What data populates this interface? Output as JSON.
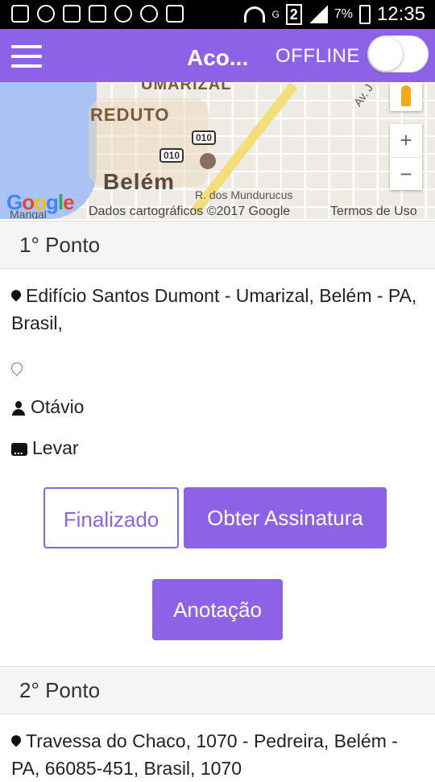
{
  "statusbar": {
    "badge": "2",
    "battery": "7%",
    "time": "12:35",
    "network": "G"
  },
  "appbar": {
    "title": "Aco...",
    "offline_label": "OFFLINE",
    "toggle_on": false
  },
  "map": {
    "labels": {
      "district_top": "UMARIZAL",
      "district": "REDUTO",
      "city": "Belém",
      "street": "R. dos Mundurucus",
      "avenue": "Av. J",
      "route1": "010",
      "route2": "010",
      "bottom_left": "Mangal"
    },
    "logo": "Google",
    "attribution": "Dados cartográficos ©2017 Google",
    "terms": "Termos de Uso",
    "zoom_in": "+",
    "zoom_out": "−"
  },
  "points": [
    {
      "header": "1° Ponto",
      "address": "Edifício Santos Dumont - Umarizal, Belém - PA, Brasil,",
      "person": "Otávio",
      "note": "Levar",
      "buttons": {
        "finalize": "Finalizado",
        "signature": "Obter Assinatura",
        "annotation": "Anotação"
      }
    },
    {
      "header": "2° Ponto",
      "address": "Travessa do Chaco, 1070 - Pedreira, Belém - PA, 66085-451, Brasil, 1070"
    }
  ],
  "colors": {
    "primary": "#8c63e6",
    "statusbar": "#000000"
  }
}
